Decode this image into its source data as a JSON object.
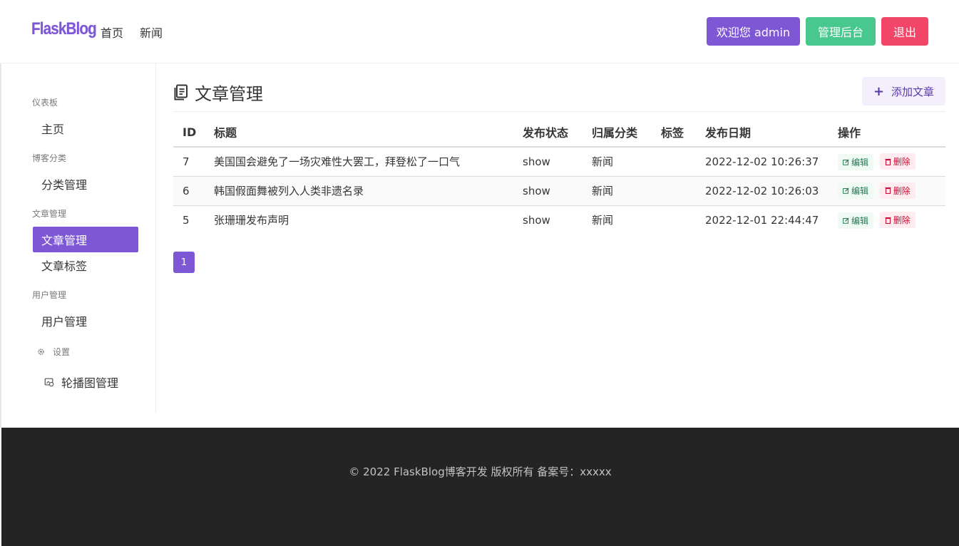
{
  "navbar": {
    "brand": "FlaskBlog",
    "links": [
      "首页",
      "新闻"
    ],
    "welcome_button": "欢迎您 admin",
    "admin_button": "管理后台",
    "logout_button": "退出",
    "colors": {
      "welcome": "#7e57d4",
      "admin": "#48c78e",
      "logout": "#f14668"
    }
  },
  "sidebar": {
    "sections": [
      {
        "label": "仪表板",
        "items": [
          "主页"
        ]
      },
      {
        "label": "博客分类",
        "items": [
          "分类管理"
        ]
      },
      {
        "label": "文章管理",
        "items": [
          "文章管理",
          "文章标签"
        ]
      },
      {
        "label": "用户管理",
        "items": [
          "用户管理"
        ]
      },
      {
        "label": "设置",
        "items": [
          "轮播图管理"
        ]
      }
    ],
    "active_item": "文章管理"
  },
  "main": {
    "title": "文章管理",
    "add_button": "添加文章",
    "table": {
      "headers": [
        "ID",
        "标题",
        "发布状态",
        "归属分类",
        "标签",
        "发布日期",
        "操作"
      ],
      "rows": [
        [
          "7",
          "美国国会避免了一场灾难性大罢工，拜登松了一口气",
          "show",
          "新闻",
          "",
          "2022-12-02 10:26:37"
        ],
        [
          "6",
          "韩国假面舞被列入人类非遗名录",
          "show",
          "新闻",
          "",
          "2022-12-02 10:26:03"
        ],
        [
          "5",
          "张珊珊发布声明",
          "show",
          "新闻",
          "",
          "2022-12-01 22:44:47"
        ]
      ],
      "edit_label": "编辑",
      "delete_label": "删除"
    },
    "pagination": {
      "current_page": "1"
    }
  },
  "footer": {
    "text": "© 2022 FlaskBlog博客开发 版权所有 备案号：xxxxx"
  }
}
